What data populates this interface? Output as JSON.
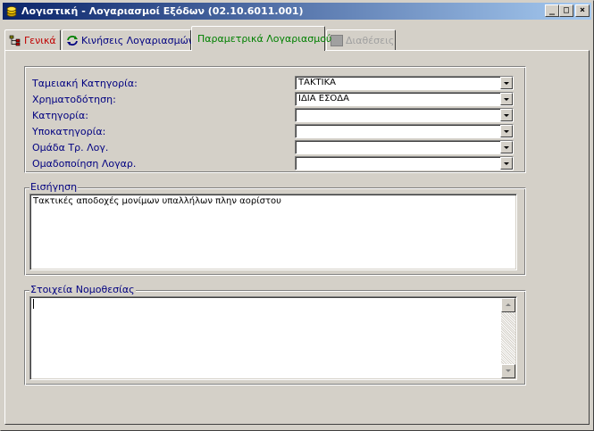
{
  "window": {
    "title": "Λογιστική - Λογαριασμοί Εξόδων (02.10.6011.001)",
    "controls": [
      "_",
      "□",
      "×"
    ]
  },
  "tabs": [
    {
      "label": "Γενικά",
      "icon": "tree-icon",
      "active": false,
      "enabled": true
    },
    {
      "label": "Κινήσεις Λογαριασμών",
      "icon": "refresh-icon",
      "active": false,
      "enabled": true
    },
    {
      "label": "Παραμετρικά Λογαριασμού",
      "icon": "",
      "active": true,
      "enabled": true
    },
    {
      "label": "Διαθέσεις",
      "icon": "gray-square-icon",
      "active": false,
      "enabled": false
    }
  ],
  "form": {
    "fields": [
      {
        "label": "Ταμειακή Κατηγορία:",
        "value": "ΤΑΚΤΙΚΑ"
      },
      {
        "label": "Χρηματοδότηση:",
        "value": "ΙΔΙΑ ΕΣΟΔΑ"
      },
      {
        "label": "Κατηγορία:",
        "value": ""
      },
      {
        "label": "Υποκατηγορία:",
        "value": ""
      },
      {
        "label": "Ομάδα Τρ. Λογ.",
        "value": ""
      },
      {
        "label": "Ομαδοποίηση Λογαρ.",
        "value": ""
      }
    ]
  },
  "proposal": {
    "label": "Εισήγηση",
    "text": "Τακτικές αποδοχές μονίμων υπαλλήλων πλην αορίστου"
  },
  "legislation": {
    "label": "Στοιχεία Νομοθεσίας",
    "text": ""
  }
}
